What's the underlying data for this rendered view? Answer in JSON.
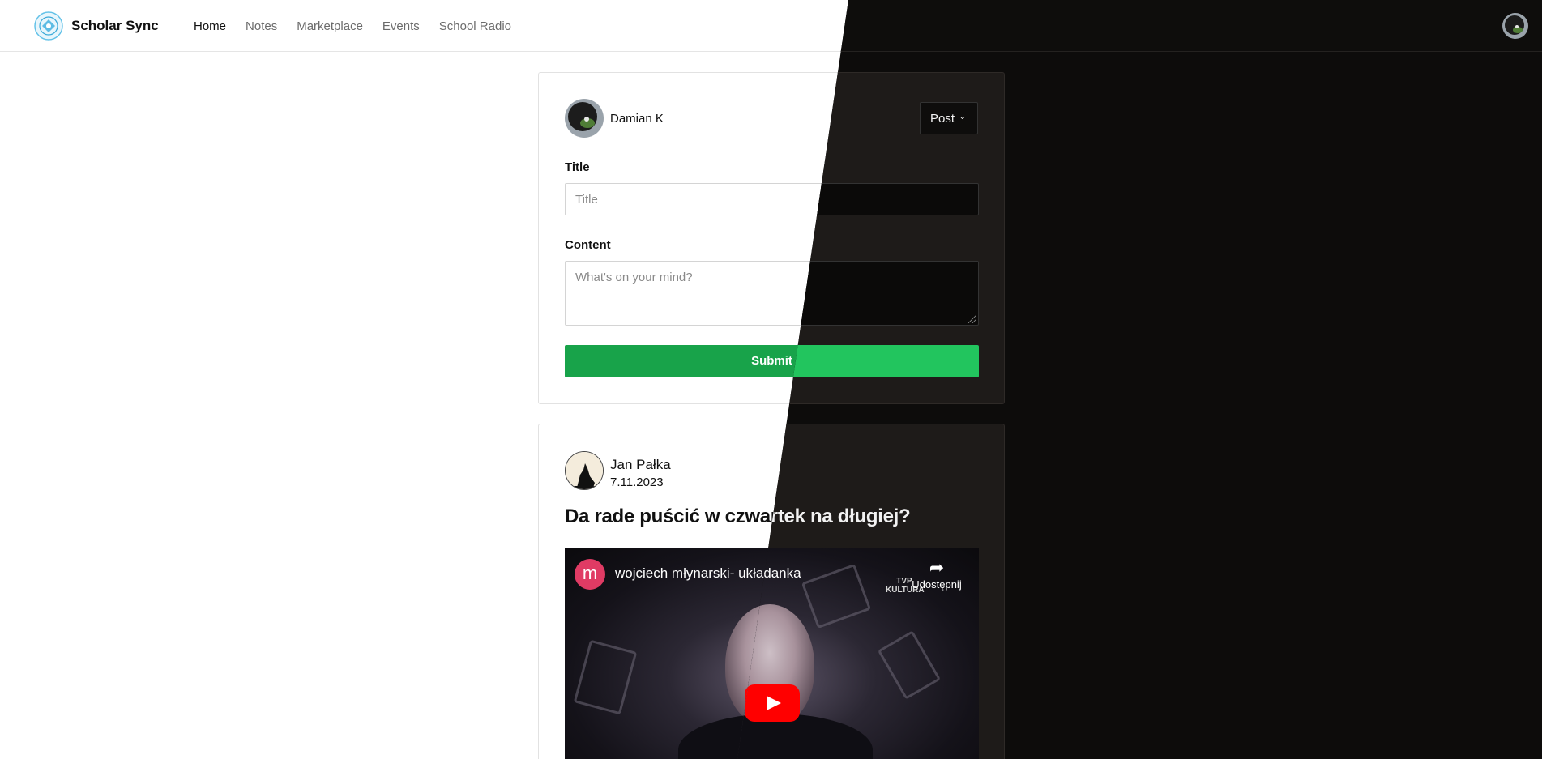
{
  "app": {
    "name": "Scholar Sync"
  },
  "nav": {
    "items": [
      "Home",
      "Notes",
      "Marketplace",
      "Events",
      "School Radio"
    ],
    "active": "Home"
  },
  "compose": {
    "author": "Damian K",
    "type_select": "Post",
    "title_label": "Title",
    "title_placeholder": "Title",
    "content_label": "Content",
    "content_placeholder": "What's on your mind?",
    "submit_label": "Submit"
  },
  "post": {
    "author": "Jan Pałka",
    "date": "7.11.2023",
    "title": "Da rade puścić w czwartek na długiej?",
    "video": {
      "channel_initial": "m",
      "title": "wojciech młynarski- układanka",
      "logo_text": "TVP KULTURA",
      "share_label": "Udostępnij"
    }
  },
  "colors": {
    "accent_light": "#18a34a",
    "accent_dark": "#22c55e",
    "youtube_red": "#ff0000",
    "channel_pink": "#e03b64"
  },
  "icons": [
    "logo-icon",
    "chevron-down-icon",
    "share-icon",
    "play-icon"
  ]
}
